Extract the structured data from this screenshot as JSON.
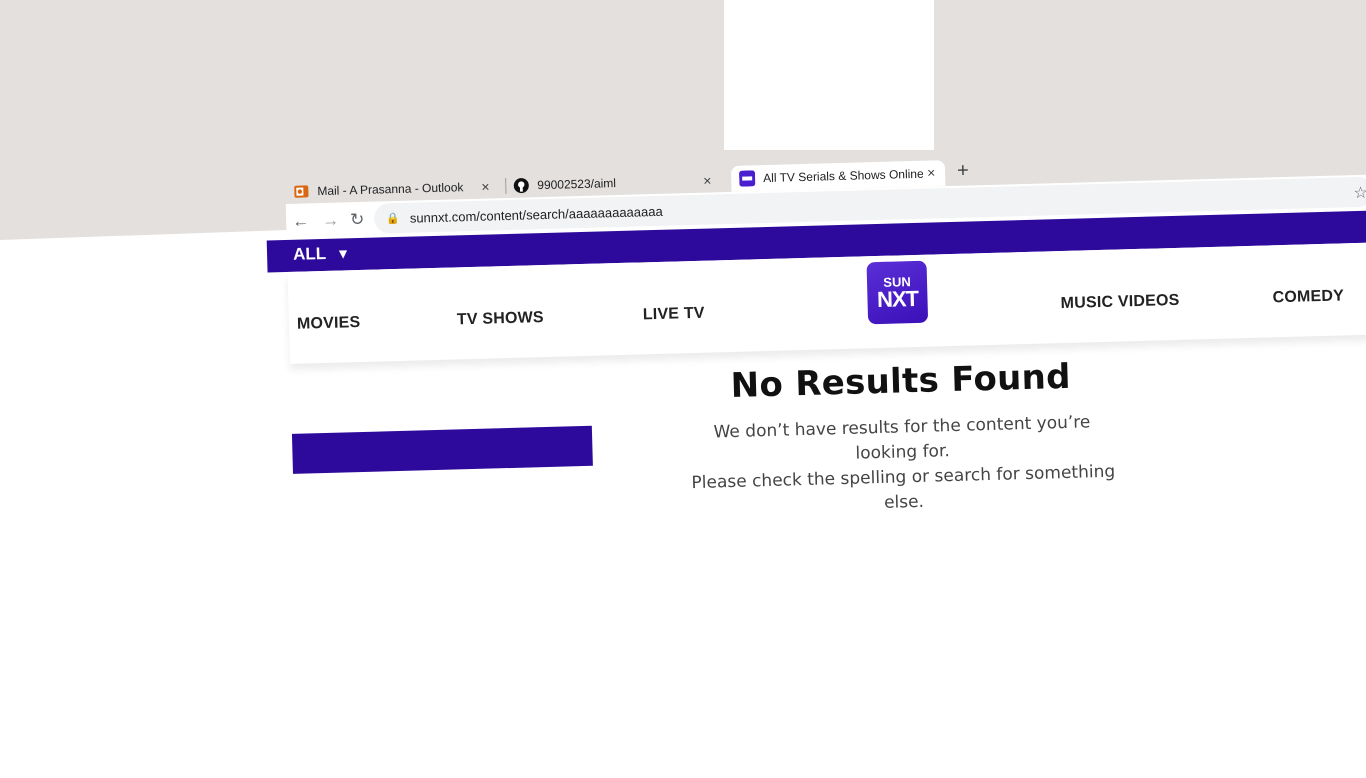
{
  "browser": {
    "tabs": [
      {
        "title": "Mail - A Prasanna - Outlook",
        "icon": "outlook-icon",
        "active": false
      },
      {
        "title": "99002523/aiml",
        "icon": "github-icon",
        "active": false
      },
      {
        "title": "All TV Serials & Shows Online | Wat",
        "icon": "sunnxt-icon",
        "active": true
      }
    ],
    "new_tab_label": "+",
    "close_label": "×",
    "address": "sunnxt.com/content/search/aaaaaaaaaaaaa"
  },
  "site": {
    "category": "ALL",
    "nav": {
      "movies": "MOVIES",
      "tv_shows": "TV SHOWS",
      "live_tv": "LIVE TV",
      "music_videos": "MUSIC VIDEOS",
      "comedy": "COMEDY"
    },
    "logo": {
      "top": "SUN",
      "bottom": "NXT"
    }
  },
  "result": {
    "heading": "No Results Found",
    "line1": "We don’t have results for the content you’re looking for.",
    "line2": "Please check the spelling or search for something else."
  },
  "colors": {
    "brand": "#2d0a9c",
    "logo": "#4a1fcf"
  }
}
